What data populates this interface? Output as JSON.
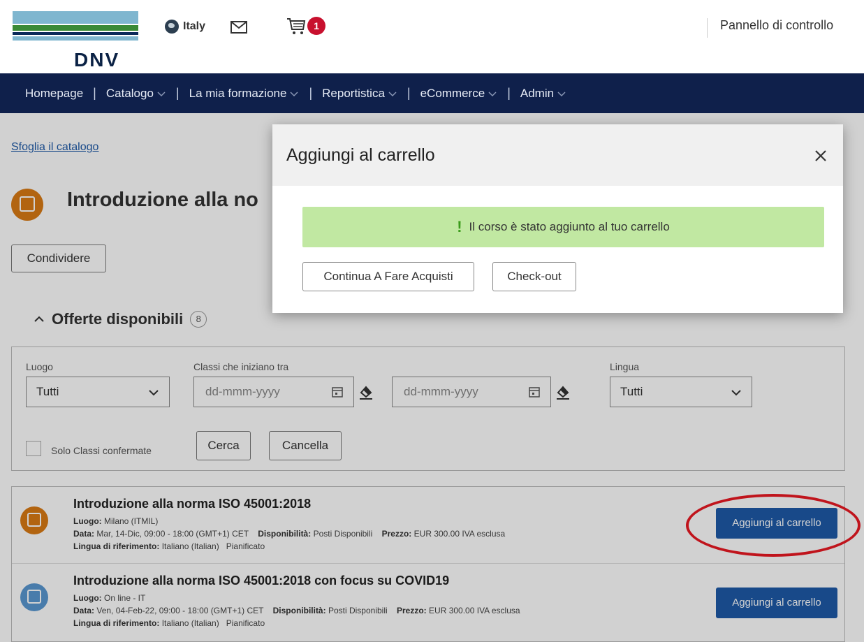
{
  "header": {
    "logo_text": "DNV",
    "locale": "Italy",
    "cart_count": "1",
    "panel_link": "Pannello di controllo"
  },
  "nav": {
    "items": [
      {
        "label": "Homepage",
        "dropdown": false
      },
      {
        "label": "Catalogo",
        "dropdown": true
      },
      {
        "label": "La mia formazione",
        "dropdown": true
      },
      {
        "label": "Reportistica",
        "dropdown": true
      },
      {
        "label": "eCommerce",
        "dropdown": true
      },
      {
        "label": "Admin",
        "dropdown": true
      }
    ]
  },
  "page": {
    "breadcrumb": "Sfoglia il catalogo",
    "course_title": "Introduzione alla no",
    "share_label": "Condividere",
    "offers_title": "Offerte disponibili",
    "offers_count": "8"
  },
  "filters": {
    "location_label": "Luogo",
    "location_value": "Tutti",
    "classes_label": "Classi che iniziano tra",
    "date_from_placeholder": "dd-mmm-yyyy",
    "date_to_placeholder": "dd-mmm-yyyy",
    "language_label": "Lingua",
    "language_value": "Tutti",
    "confirmed_only_label": "Solo Classi confermate",
    "search_label": "Cerca",
    "clear_label": "Cancella"
  },
  "results": [
    {
      "title": "Introduzione alla norma ISO 45001:2018",
      "location_key": "Luogo:",
      "location": "Milano (ITMIL)",
      "date_key": "Data:",
      "date": "Mar, 14-Dic, 09:00 - 18:00 (GMT+1) CET",
      "availability_key": "Disponibilità:",
      "availability": "Posti Disponibili",
      "price_key": "Prezzo:",
      "price": "EUR 300.00 IVA esclusa",
      "lang_key": "Lingua di riferimento:",
      "lang": "Italiano (Italian)",
      "status": "Pianificato",
      "button": "Aggiungi al carrello"
    },
    {
      "title": "Introduzione alla norma ISO 45001:2018 con focus su COVID19",
      "location_key": "Luogo:",
      "location": "On line - IT",
      "date_key": "Data:",
      "date": "Ven, 04-Feb-22, 09:00 - 18:00 (GMT+1) CET",
      "availability_key": "Disponibilità:",
      "availability": "Posti Disponibili",
      "price_key": "Prezzo:",
      "price": "EUR 300.00 IVA esclusa",
      "lang_key": "Lingua di riferimento:",
      "lang": "Italiano (Italian)",
      "status": "Pianificato",
      "button": "Aggiungi al carrello"
    }
  ],
  "modal": {
    "title": "Aggiungi al carrello",
    "alert_icon": "!",
    "alert_text": "Il corso è stato aggiunto al tuo carrello",
    "continue_label": "Continua A Fare Acquisti",
    "checkout_label": "Check-out"
  },
  "colors": {
    "nav_bg": "#0f204b",
    "primary_button": "#1e5aa8",
    "success_bg": "#c1e8a2",
    "cart_badge": "#c8102e",
    "annotation": "#c0141c"
  }
}
